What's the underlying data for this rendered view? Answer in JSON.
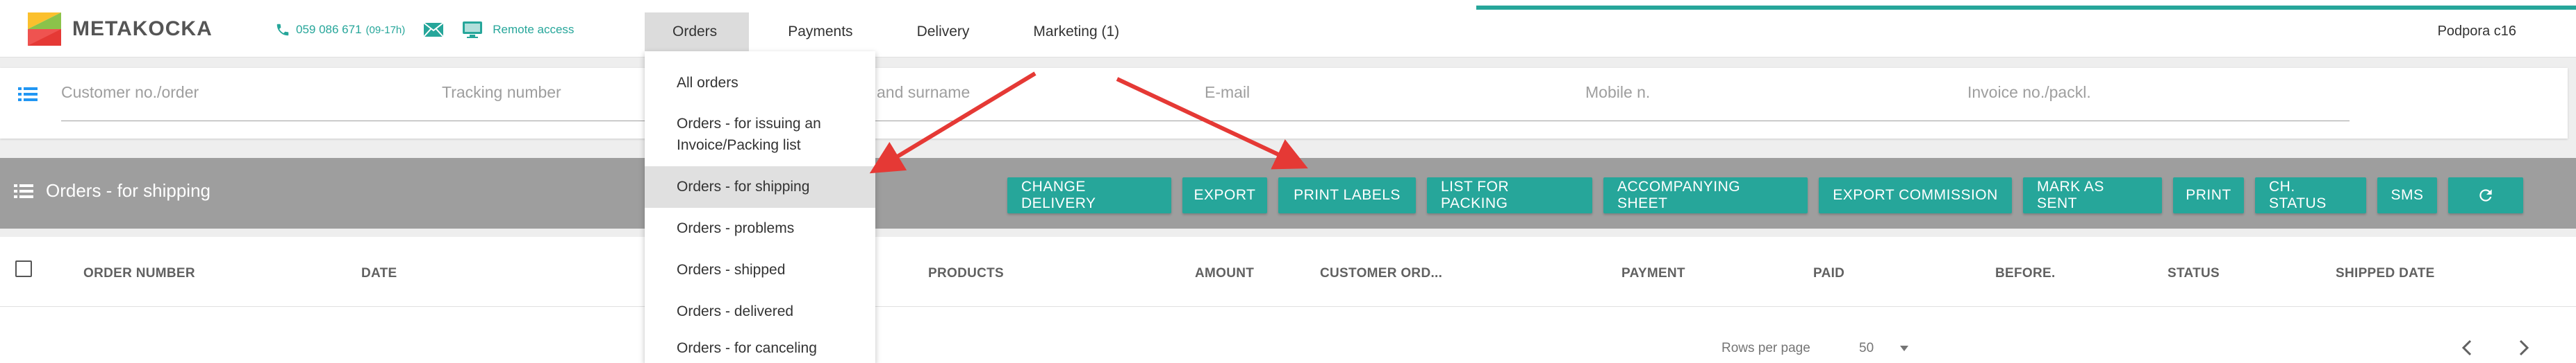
{
  "brand": {
    "name": "METAKOCKA"
  },
  "contact": {
    "phone": "059 086 671",
    "hours": "(09-17h)",
    "remote_access": "Remote access"
  },
  "nav": [
    {
      "label": "Orders"
    },
    {
      "label": "Payments"
    },
    {
      "label": "Delivery"
    },
    {
      "label": "Marketing (1)"
    }
  ],
  "user": {
    "label": "Podpora c16"
  },
  "colors": {
    "accent": "#26a69a",
    "header_bar": "#9e9e9e",
    "arrow": "#e53935"
  },
  "filters": [
    {
      "placeholder": "Customer no./order"
    },
    {
      "placeholder": "Tracking number"
    },
    {
      "placeholder": "and surname"
    },
    {
      "placeholder": "E-mail"
    },
    {
      "placeholder": "Mobile n."
    },
    {
      "placeholder": "Invoice no./packl."
    }
  ],
  "orders_header": {
    "title": "Orders - for shipping"
  },
  "toolbar": [
    {
      "label": "CHANGE DELIVERY"
    },
    {
      "label": "EXPORT"
    },
    {
      "label": "PRINT LABELS"
    },
    {
      "label": "LIST FOR PACKING"
    },
    {
      "label": "ACCOMPANYING SHEET"
    },
    {
      "label": "EXPORT COMMISSION"
    },
    {
      "label": "MARK AS SENT"
    },
    {
      "label": "PRINT"
    },
    {
      "label": "CH. STATUS"
    },
    {
      "label": "SMS"
    },
    {
      "icon": "refresh-icon"
    }
  ],
  "table": {
    "columns": [
      "ORDER NUMBER",
      "DATE",
      "PRODUCTS",
      "AMOUNT",
      "CUSTOMER ORD...",
      "PAYMENT",
      "PAID",
      "BEFORE.",
      "STATUS",
      "SHIPPED DATE"
    ]
  },
  "pagination": {
    "rows_label": "Rows per page",
    "rows_value": "50"
  },
  "dropdown": {
    "items": [
      {
        "label": "All orders"
      },
      {
        "label": "Orders - for issuing an",
        "label2": "Invoice/Packing list"
      },
      {
        "label": "Orders - for shipping",
        "selected": true
      },
      {
        "label": "Orders - problems"
      },
      {
        "label": "Orders - shipped"
      },
      {
        "label": "Orders - delivered"
      },
      {
        "label": "Orders - for canceling"
      }
    ]
  }
}
